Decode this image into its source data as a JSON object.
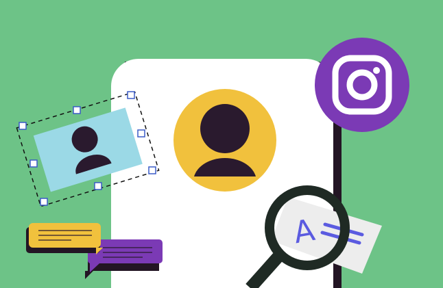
{
  "scene": {
    "colors": {
      "background": "#6DC387",
      "card": "#FFFFFF",
      "dark": "#2A1A2E",
      "yellow": "#F1C13D",
      "purple": "#7B3AB5",
      "light_blue": "#9BD9E6",
      "accent_blue": "#5B5BE0",
      "paper": "#EDEDED",
      "lens_ring": "#1F2A24",
      "selection_handle": "#3A5BC7"
    },
    "elements": {
      "phone_card": "profile-card",
      "avatar": "avatar-yellow-circle",
      "instagram_badge": "instagram-icon",
      "photo_frame": "selected-photo-frame",
      "chat_bubbles": [
        "yellow-chat-bubble",
        "purple-chat-bubble"
      ],
      "magnifier": "magnifying-glass-icon",
      "glyph": {
        "letter": "A",
        "symbol": "="
      }
    }
  }
}
